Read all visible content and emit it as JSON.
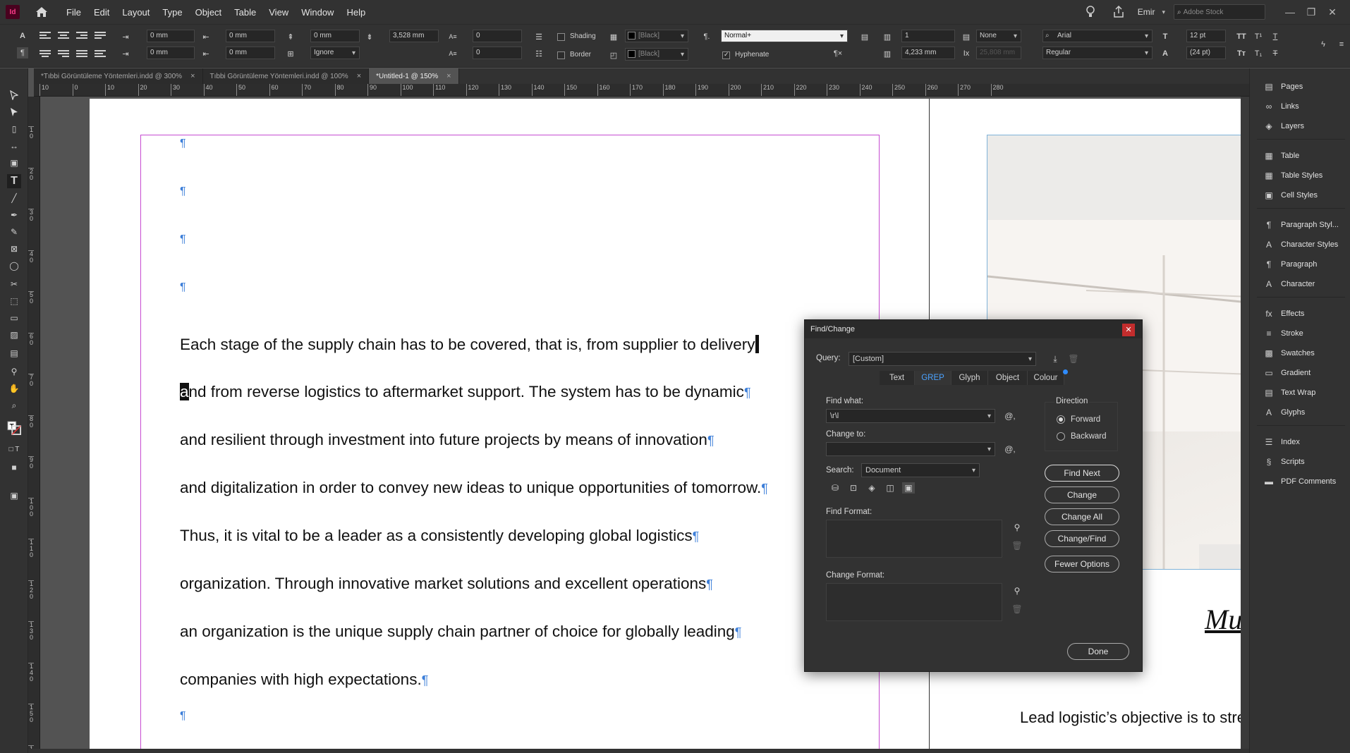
{
  "app": {
    "logo": "Id",
    "menu": [
      "File",
      "Edit",
      "Layout",
      "Type",
      "Object",
      "Table",
      "View",
      "Window",
      "Help"
    ],
    "user": "Emir",
    "stock_search_placeholder": "Adobe Stock",
    "window_buttons": [
      "—",
      "❐",
      "✕"
    ]
  },
  "controlbar": {
    "left_indent": "0 mm",
    "right_indent": "0 mm",
    "first_line_indent": "0 mm",
    "last_line_indent": "0 mm",
    "space_before": "0 mm",
    "space_after": "3,528 mm",
    "align_to_grid": "Ignore",
    "drop_cap_lines": "0",
    "drop_cap_chars": "0",
    "shading_label": "Shading",
    "border_label": "Border",
    "shading_color": "[Black]",
    "border_color": "[Black]",
    "paragraph_style": "Normal+",
    "hyphenate_label": "Hyphenate",
    "columns": "1",
    "column_gutter": "4,233 mm",
    "span_value": "None",
    "gutter_disabled": "25,808 mm",
    "font_family": "Arial",
    "font_style": "Regular",
    "font_size": "12 pt",
    "leading": "(24 pt)"
  },
  "tabs": [
    {
      "label": "*Tıbbi Görüntüleme Yöntemleri.indd @ 300%",
      "active": false
    },
    {
      "label": "Tıbbi Görüntüleme Yöntemleri.indd @ 100%",
      "active": false
    },
    {
      "label": "*Untitled-1 @ 150%",
      "active": true
    }
  ],
  "ruler_h": [
    "10",
    "0",
    "10",
    "20",
    "30",
    "40",
    "50",
    "60",
    "70",
    "80",
    "90",
    "100",
    "110",
    "120",
    "130",
    "140",
    "150",
    "160",
    "170",
    "180",
    "190",
    "200",
    "210",
    "220",
    "230",
    "240",
    "250",
    "260",
    "270",
    "280"
  ],
  "ruler_v": [
    "1 0",
    "2 0",
    "3 0",
    "4 0",
    "5 0",
    "6 0",
    "7 0",
    "8 0",
    "9 0",
    "1 0 0",
    "1 1 0",
    "1 2 0",
    "1 3 0",
    "1 4 0",
    "1 5 0",
    "1 6 0"
  ],
  "document": {
    "lines": [
      {
        "before": "Each stage of the supply chain has to be covered, that is, from supplier to delivery",
        "sel": "",
        "after": ""
      },
      {
        "before": "",
        "sel": "a",
        "after": "nd from reverse logistics to aftermarket support. The system has to be dynamic"
      },
      {
        "before": "and resilient through investment into future projects by means of innovation",
        "sel": "",
        "after": ""
      },
      {
        "before": "and digitalization in order to convey new ideas to unique opportunities of tomorrow.",
        "sel": "",
        "after": ""
      },
      {
        "before": "Thus, it is vital to be a leader as a consistently developing global logistics",
        "sel": "",
        "after": ""
      },
      {
        "before": "organization. Through innovative market solutions and excellent operations",
        "sel": "",
        "after": ""
      },
      {
        "before": "an organization is the unique supply chain partner of choice for globally leading",
        "sel": "",
        "after": ""
      },
      {
        "before": "companies with high expectations.",
        "sel": "",
        "after": ""
      }
    ],
    "pilcrow": "¶",
    "right_heading": "Multin",
    "right_body": "Lead logistic’s objective is to stream"
  },
  "dialog": {
    "title": "Find/Change",
    "query_label": "Query:",
    "query_value": "[Custom]",
    "tabs": [
      "Text",
      "GREP",
      "Glyph",
      "Object",
      "Colour"
    ],
    "active_tab": "GREP",
    "find_what_label": "Find what:",
    "find_what_value": "\\r\\l",
    "change_to_label": "Change to:",
    "change_to_value": "",
    "search_label": "Search:",
    "search_value": "Document",
    "find_format_label": "Find Format:",
    "change_format_label": "Change Format:",
    "direction_label": "Direction",
    "forward_label": "Forward",
    "backward_label": "Backward",
    "buttons": {
      "find_next": "Find Next",
      "change": "Change",
      "change_all": "Change All",
      "change_find": "Change/Find",
      "fewer_options": "Fewer Options",
      "done": "Done"
    }
  },
  "panel": [
    {
      "label": "Pages",
      "icon": "pages-icon",
      "glyph": "▤"
    },
    {
      "label": "Links",
      "icon": "links-icon",
      "glyph": "∞"
    },
    {
      "label": "Layers",
      "icon": "layers-icon",
      "glyph": "◈"
    },
    {
      "label": "Table",
      "icon": "table-icon",
      "glyph": "▦"
    },
    {
      "label": "Table Styles",
      "icon": "table-styles-icon",
      "glyph": "▦"
    },
    {
      "label": "Cell Styles",
      "icon": "cell-styles-icon",
      "glyph": "▣"
    },
    {
      "label": "Paragraph Styl...",
      "icon": "paragraph-styles-icon",
      "glyph": "¶"
    },
    {
      "label": "Character Styles",
      "icon": "character-styles-icon",
      "glyph": "A"
    },
    {
      "label": "Paragraph",
      "icon": "paragraph-icon",
      "glyph": "¶"
    },
    {
      "label": "Character",
      "icon": "character-icon",
      "glyph": "A"
    },
    {
      "label": "Effects",
      "icon": "effects-icon",
      "glyph": "fx"
    },
    {
      "label": "Stroke",
      "icon": "stroke-icon",
      "glyph": "≡"
    },
    {
      "label": "Swatches",
      "icon": "swatches-icon",
      "glyph": "▩"
    },
    {
      "label": "Gradient",
      "icon": "gradient-icon",
      "glyph": "▭"
    },
    {
      "label": "Text Wrap",
      "icon": "text-wrap-icon",
      "glyph": "▤"
    },
    {
      "label": "Glyphs",
      "icon": "glyphs-icon",
      "glyph": "A"
    },
    {
      "label": "Index",
      "icon": "index-icon",
      "glyph": "☰"
    },
    {
      "label": "Scripts",
      "icon": "scripts-icon",
      "glyph": "§"
    },
    {
      "label": "PDF Comments",
      "icon": "pdf-comments-icon",
      "glyph": "▬"
    }
  ]
}
